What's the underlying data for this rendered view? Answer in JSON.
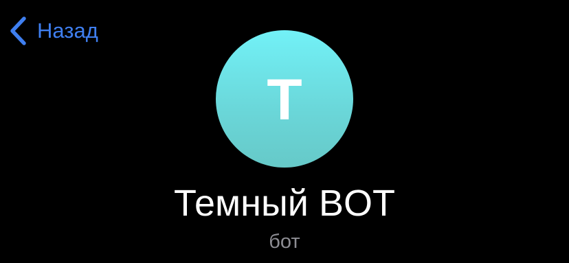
{
  "header": {
    "back_label": "Назад",
    "back_icon": "chevron-left-icon"
  },
  "profile": {
    "avatar_initial": "T",
    "name": "Темный BOT",
    "status": "бот"
  },
  "colors": {
    "background": "#000000",
    "accent": "#3f7ff0",
    "avatar_top": "#72f1f7",
    "avatar_bottom": "#66c9c8",
    "secondary_text": "#8d8d93"
  }
}
